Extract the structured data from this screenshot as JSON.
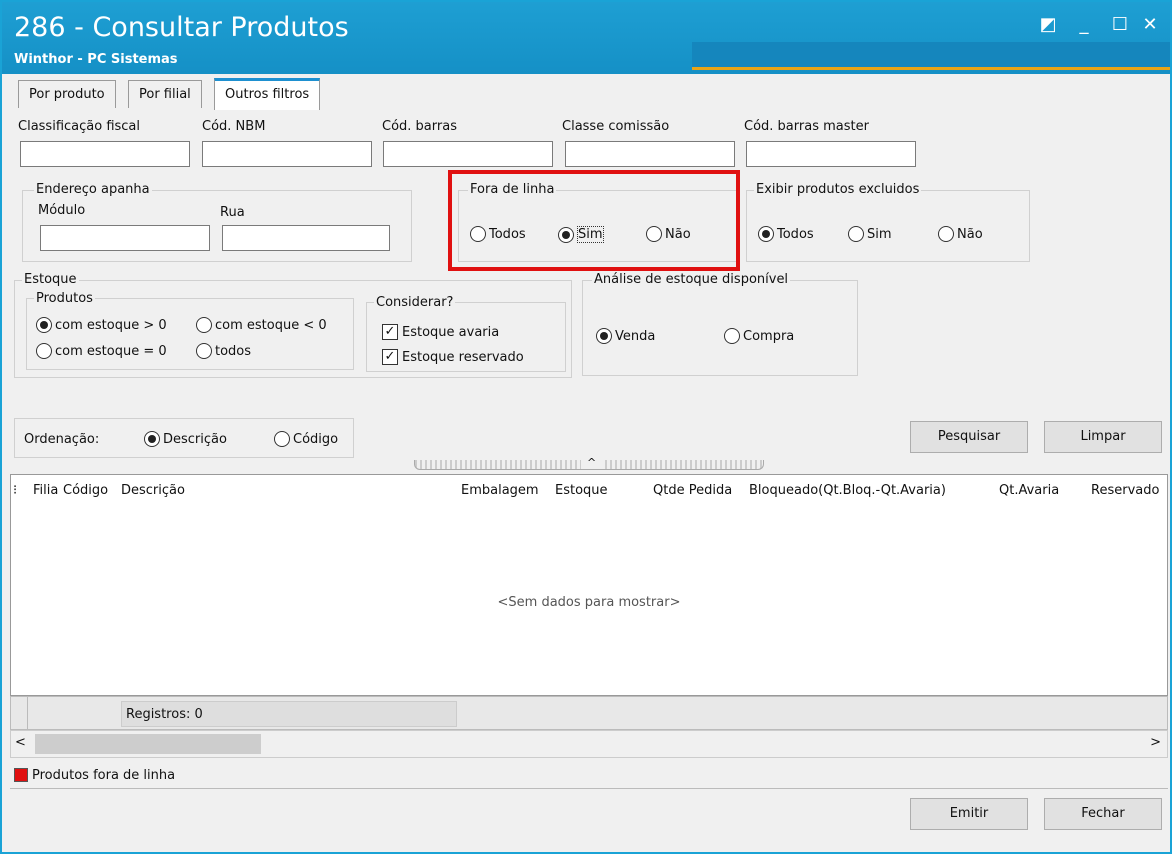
{
  "window": {
    "title": "286 - Consultar Produtos",
    "subtitle": "Winthor - PC Sistemas",
    "accent": "#1aa3d6",
    "controls": {
      "restore": "◩",
      "minimize": "_",
      "maximize": "☐",
      "close": "✕"
    }
  },
  "tabs": [
    {
      "label": "Por produto"
    },
    {
      "label": "Por filial"
    },
    {
      "label": "Outros filtros"
    }
  ],
  "filters": {
    "classificacao_fiscal": {
      "label": "Classificação fiscal",
      "value": ""
    },
    "cod_nbm": {
      "label": "Cód. NBM",
      "value": ""
    },
    "cod_barras": {
      "label": "Cód. barras",
      "value": ""
    },
    "classe_comissao": {
      "label": "Classe comissão",
      "value": ""
    },
    "cod_barras_master": {
      "label": "Cód. barras master",
      "value": ""
    }
  },
  "endereco": {
    "title": "Endereço apanha",
    "modulo_label": "Módulo",
    "rua_label": "Rua"
  },
  "fora_de_linha": {
    "title": "Fora de linha",
    "options": [
      "Todos",
      "Sim",
      "Não"
    ],
    "selected": "Sim"
  },
  "excluidos": {
    "title": "Exibir produtos excluidos",
    "options": [
      "Todos",
      "Sim",
      "Não"
    ],
    "selected": "Todos"
  },
  "estoque": {
    "title": "Estoque",
    "produtos_title": "Produtos",
    "opt_maior": "com estoque > 0",
    "opt_menor": "com estoque < 0",
    "opt_igual": "com estoque = 0",
    "opt_todos": "todos",
    "selected": "com estoque > 0",
    "considerar_title": "Considerar?",
    "avaria": "Estoque avaria",
    "reservado": "Estoque reservado"
  },
  "analise": {
    "title": "Análise de estoque disponível",
    "venda": "Venda",
    "compra": "Compra",
    "selected": "Venda"
  },
  "ordenacao": {
    "label": "Ordenação:",
    "descricao": "Descrição",
    "codigo": "Código",
    "selected": "Descrição"
  },
  "buttons": {
    "pesquisar": "Pesquisar",
    "limpar": "Limpar",
    "emitir": "Emitir",
    "fechar": "Fechar"
  },
  "grid": {
    "columns": [
      "Filia",
      "Código",
      "Descrição",
      "Embalagem",
      "Estoque",
      "Qtde Pedida",
      "Bloqueado(Qt.Bloq.-Qt.Avaria)",
      "Qt.Avaria",
      "Reservado"
    ],
    "empty_text": "<Sem dados para mostrar>",
    "registros": "Registros: 0"
  },
  "legend": {
    "label": "Produtos fora de linha",
    "color": "#e01010"
  }
}
